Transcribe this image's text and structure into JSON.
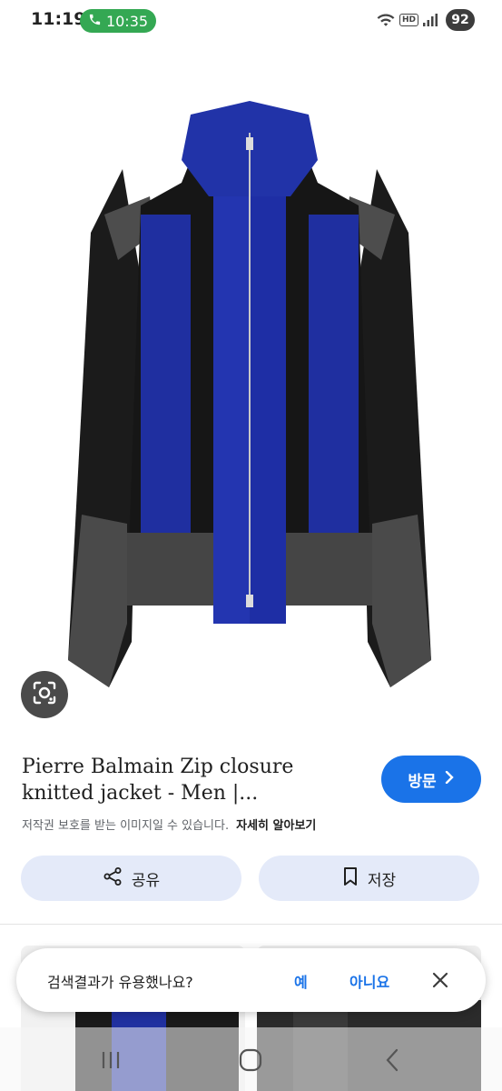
{
  "status_bar": {
    "time": "11:19",
    "call_duration": "10:35",
    "battery": "92",
    "network_badge": "HD",
    "accent_call": "#34a853"
  },
  "product": {
    "title": "Pierre Balmain Zip closure knitted jacket - Men |...",
    "visit_label": "방문",
    "copyright_notice": "저작권 보호를 받는 이미지일 수 있습니다.",
    "learn_more": "자세히 알아보기",
    "accent": "#1a73e8"
  },
  "actions": {
    "share_label": "공유",
    "save_label": "저장"
  },
  "feedback": {
    "question": "검색결과가 유용했나요?",
    "yes_label": "예",
    "no_label": "아니요"
  },
  "icons": [
    "phone-icon",
    "wifi-icon",
    "signal-icon",
    "lens-icon",
    "chevron-right-icon",
    "share-icon",
    "bookmark-icon",
    "close-icon",
    "recent-apps-icon",
    "home-icon",
    "back-icon"
  ]
}
